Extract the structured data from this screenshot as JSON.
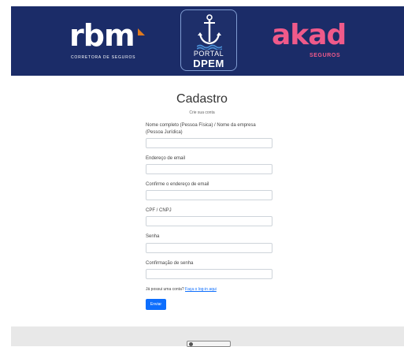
{
  "header": {
    "rbm_logo": "rbm",
    "rbm_subtitle": "CORRETORA DE SEGUROS",
    "portal_line1": "PORTAL",
    "portal_line2": "DPEM",
    "akad_logo": "akad",
    "akad_subtitle": "SEGUROS",
    "colors": {
      "banner": "#1b2c68",
      "rbm_accent": "#e07a1f",
      "akad": "#f05a8a"
    }
  },
  "form": {
    "title": "Cadastro",
    "subtitle": "Crie sua conta",
    "fields": [
      {
        "label": "Nome completo (Pessoa Física) / Nome da empresa (Pessoa Jurídica)",
        "value": ""
      },
      {
        "label": "Endereço de email",
        "value": ""
      },
      {
        "label": "Confirme o endereço de email",
        "value": ""
      },
      {
        "label": "CPF / CNPJ",
        "value": ""
      },
      {
        "label": "Senha",
        "value": ""
      },
      {
        "label": "Confirmação de senha",
        "value": ""
      }
    ],
    "login_prompt": "Já possui uma conta?",
    "login_link": "Faça o log-in aqui",
    "submit_label": "Enviar",
    "colors": {
      "primary": "#0d6efd"
    }
  },
  "footer": {
    "pill_icon": "circle-icon"
  }
}
